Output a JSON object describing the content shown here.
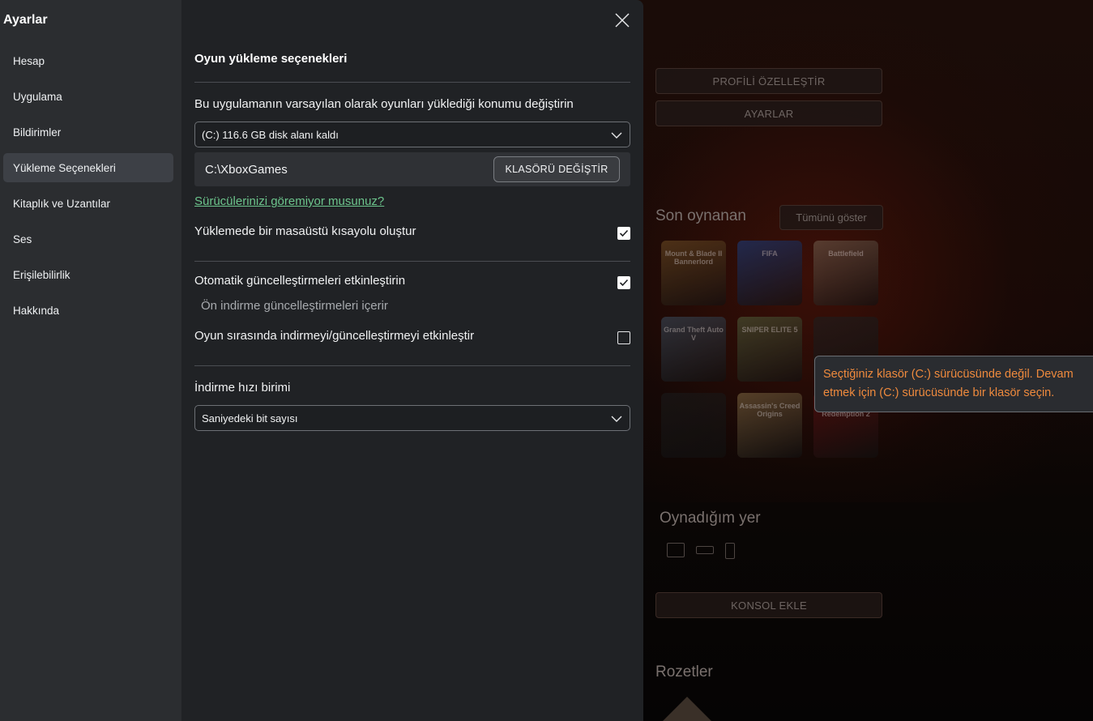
{
  "modal": {
    "title": "Ayarlar",
    "nav": [
      {
        "label": "Hesap",
        "active": false
      },
      {
        "label": "Uygulama",
        "active": false
      },
      {
        "label": "Bildirimler",
        "active": false
      },
      {
        "label": "Yükleme Seçenekleri",
        "active": true
      },
      {
        "label": "Kitaplık ve Uzantılar",
        "active": false
      },
      {
        "label": "Ses",
        "active": false
      },
      {
        "label": "Erişilebilirlik",
        "active": false
      },
      {
        "label": "Hakkında",
        "active": false
      }
    ],
    "section_title": "Oyun yükleme seçenekleri",
    "install_location_label": "Bu uygulamanın varsayılan olarak oyunları yüklediği konumu değiştirin",
    "drive_dropdown_value": "(C:) 116.6 GB disk alanı kaldı",
    "folder_path": "C:\\XboxGames",
    "change_folder_label": "KLASÖRÜ DEĞİŞTİR",
    "missing_drives_link": "Sürücülerinizi göremiyor musunuz?",
    "desktop_shortcut_label": "Yüklemede bir masaüstü kısayolu oluştur",
    "desktop_shortcut_checked": true,
    "auto_updates_label": "Otomatik güncelleştirmeleri etkinleştirin",
    "auto_updates_checked": true,
    "auto_updates_sublabel": "Ön indirme güncelleştirmeleri içerir",
    "ingame_download_label": "Oyun sırasında indirmeyi/güncelleştirmeyi etkinleştir",
    "ingame_download_checked": false,
    "speed_unit_label": "İndirme hızı birimi",
    "speed_unit_value": "Saniyedeki bit sayısı"
  },
  "tooltip": {
    "line1": "Seçtiğiniz klasör (C:) sürücüsünde değil. Devam",
    "line2": "etmek için (C:) sürücüsünde bir klasör seçin."
  },
  "background": {
    "customize_profile_label": "PROFİLİ ÖZELLEŞTİR",
    "settings_label": "AYARLAR",
    "recently_played_heading": "Son oynanan",
    "show_all_label": "Tümünü göster",
    "games": [
      {
        "title": "Mount & Blade II Bannerlord",
        "color": "#6b4a22"
      },
      {
        "title": "FIFA",
        "color": "#1d3b7a"
      },
      {
        "title": "Battlefield",
        "color": "#6e5a4a"
      },
      {
        "title": "Grand Theft Auto V",
        "color": "#3a4a5a"
      },
      {
        "title": "SNIPER ELITE 5",
        "color": "#4e5a38"
      },
      {
        "title": "",
        "color": "#1e1e1e"
      },
      {
        "title": "",
        "color": "#1a1a1a"
      },
      {
        "title": "Assassin's Creed Origins",
        "color": "#7a6440"
      },
      {
        "title": "Red Dead Redemption 2",
        "color": "#5a1010"
      }
    ],
    "played_on_heading": "Oynadığım yer",
    "add_console_label": "KONSOL EKLE",
    "badges_heading": "Rozetler",
    "accent_color": "#ef8a3d",
    "link_color": "#6cc48c"
  }
}
